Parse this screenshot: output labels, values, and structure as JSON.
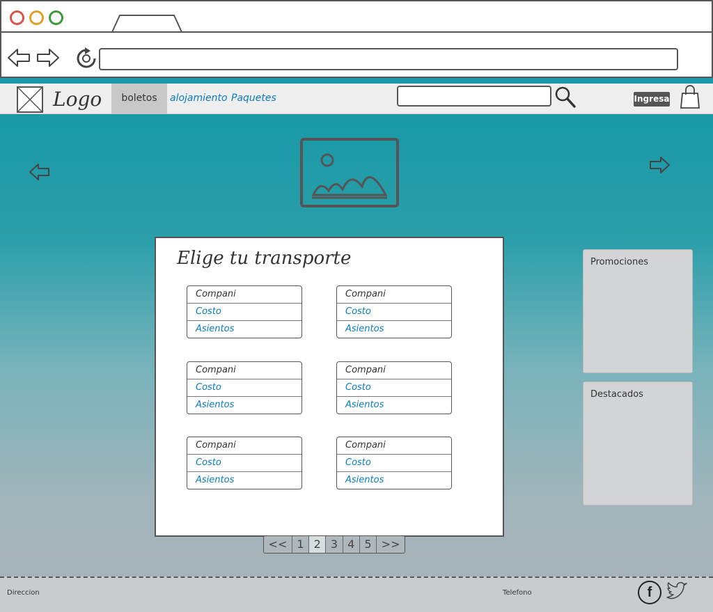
{
  "header": {
    "logo_label": "Logo",
    "nav": [
      {
        "label": "boletos",
        "active": true
      },
      {
        "label": "alojamiento",
        "active": false
      },
      {
        "label": "Paquetes",
        "active": false
      }
    ],
    "search_placeholder": "",
    "login_label": "Ingresa",
    "accent_color": "#0a7bbf",
    "icons": [
      "search-icon",
      "shopping-bag-icon"
    ]
  },
  "carousel": {
    "icons": [
      "arrow-left-icon",
      "image-placeholder-icon",
      "arrow-right-icon"
    ]
  },
  "main": {
    "title": "Elige tu transporte",
    "options": [
      {
        "company": "Compani",
        "cost": "Costo",
        "seats": "Asientos"
      },
      {
        "company": "Compani",
        "cost": "Costo",
        "seats": "Asientos"
      },
      {
        "company": "Compani",
        "cost": "Costo",
        "seats": "Asientos"
      },
      {
        "company": "Compani",
        "cost": "Costo",
        "seats": "Asientos"
      },
      {
        "company": "Compani",
        "cost": "Costo",
        "seats": "Asientos"
      },
      {
        "company": "Compani",
        "cost": "Costo",
        "seats": "Asientos"
      }
    ],
    "pagination": [
      "<<",
      "1",
      "2",
      "3",
      "4",
      "5",
      ">>"
    ],
    "current_page": "2"
  },
  "sidebar": {
    "promotions_label": "Promociones",
    "featured_label": "Destacados"
  },
  "footer": {
    "address_label": "Direccion",
    "phone_label": "Telefono",
    "social": [
      "facebook-icon",
      "twitter-icon"
    ],
    "facebook_glyph": "f"
  },
  "page_colors": {
    "header_band": "#1898a6",
    "gradient_bottom": "#a8b2b8"
  }
}
